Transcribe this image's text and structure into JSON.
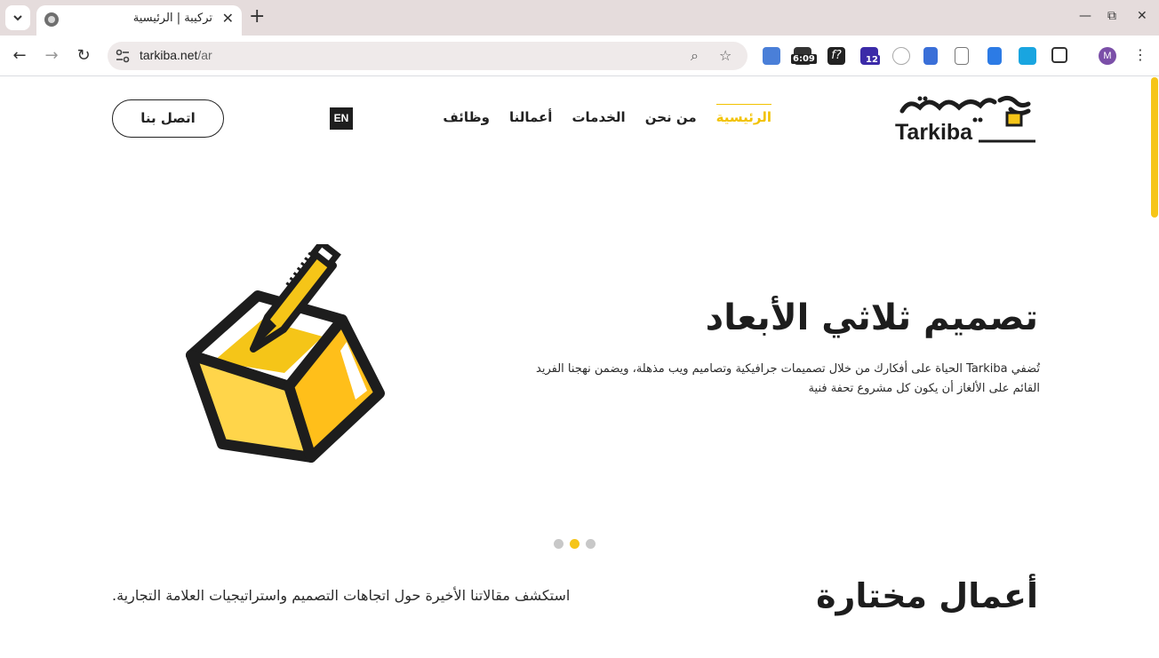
{
  "browser": {
    "tab_title": "تركيبة | الرئيسية",
    "url_domain": "tarkiba.net",
    "url_path": "/ar",
    "extension_badges": {
      "timer": "6:09",
      "school": "12"
    },
    "profile_initial": "M"
  },
  "header": {
    "logo_text": "Tarkiba",
    "nav": [
      {
        "label": "الرئيسية",
        "active": true
      },
      {
        "label": "من نحن",
        "active": false
      },
      {
        "label": "الخدمات",
        "active": false
      },
      {
        "label": "أعمالنا",
        "active": false
      },
      {
        "label": "وظائف",
        "active": false
      }
    ],
    "lang_label": "EN",
    "contact_label": "اتصل بنا"
  },
  "hero": {
    "title": "تصميم ثلاثي الأبعاد",
    "text": "تُضفي Tarkiba الحياة على أفكارك من خلال تصميمات جرافيكية وتصاميم ويب مذهلة، ويضمن نهجنا الفريد القائم على الألغاز أن يكون كل مشروع تحفة فنية",
    "slides_count": 3,
    "active_slide": 2
  },
  "featured": {
    "title": "أعمال مختارة",
    "subtitle": "استكشف مقالاتنا الأخيرة حول اتجاهات التصميم واستراتيجيات العلامة التجارية."
  },
  "colors": {
    "accent": "#f5c518",
    "text": "#1d1d1d"
  }
}
